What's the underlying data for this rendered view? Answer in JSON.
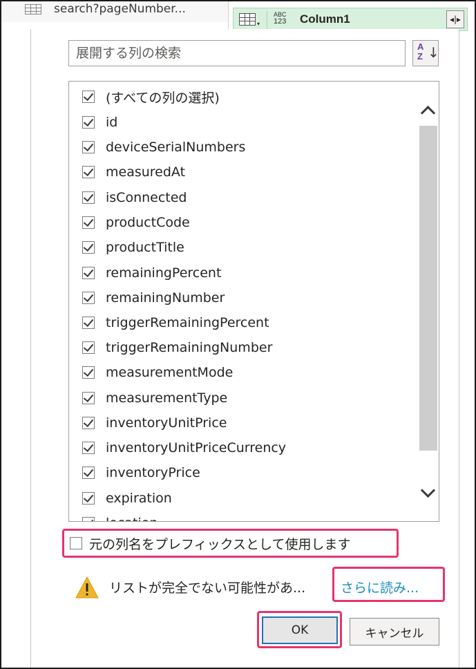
{
  "background": {
    "query_name": "search?pageNumber...",
    "column_header": {
      "type_top": "ABC",
      "type_bottom": "123",
      "name": "Column1"
    }
  },
  "dialog": {
    "search_placeholder": "展開する列の検索",
    "columns": [
      {
        "label": "(すべての列の選択)",
        "checked": true
      },
      {
        "label": "id",
        "checked": true
      },
      {
        "label": "deviceSerialNumbers",
        "checked": true
      },
      {
        "label": "measuredAt",
        "checked": true
      },
      {
        "label": "isConnected",
        "checked": true
      },
      {
        "label": "productCode",
        "checked": true
      },
      {
        "label": "productTitle",
        "checked": true
      },
      {
        "label": "remainingPercent",
        "checked": true
      },
      {
        "label": "remainingNumber",
        "checked": true
      },
      {
        "label": "triggerRemainingPercent",
        "checked": true
      },
      {
        "label": "triggerRemainingNumber",
        "checked": true
      },
      {
        "label": "measurementMode",
        "checked": true
      },
      {
        "label": "measurementType",
        "checked": true
      },
      {
        "label": "inventoryUnitPrice",
        "checked": true
      },
      {
        "label": "inventoryUnitPriceCurrency",
        "checked": true
      },
      {
        "label": "inventoryPrice",
        "checked": true
      },
      {
        "label": "expiration",
        "checked": true
      },
      {
        "label": "location",
        "checked": true
      }
    ],
    "prefix_label": "元の列名をプレフィックスとして使用します",
    "prefix_checked": false,
    "warning_text": "リストが完全でない可能性があ...",
    "load_more": "さらに読み...",
    "ok": "OK",
    "cancel": "キャンセル"
  },
  "colors": {
    "highlight": "#e8336b",
    "link": "#1a8fbf",
    "header_bg": "#d8f0de",
    "warning": "#f0b429"
  }
}
